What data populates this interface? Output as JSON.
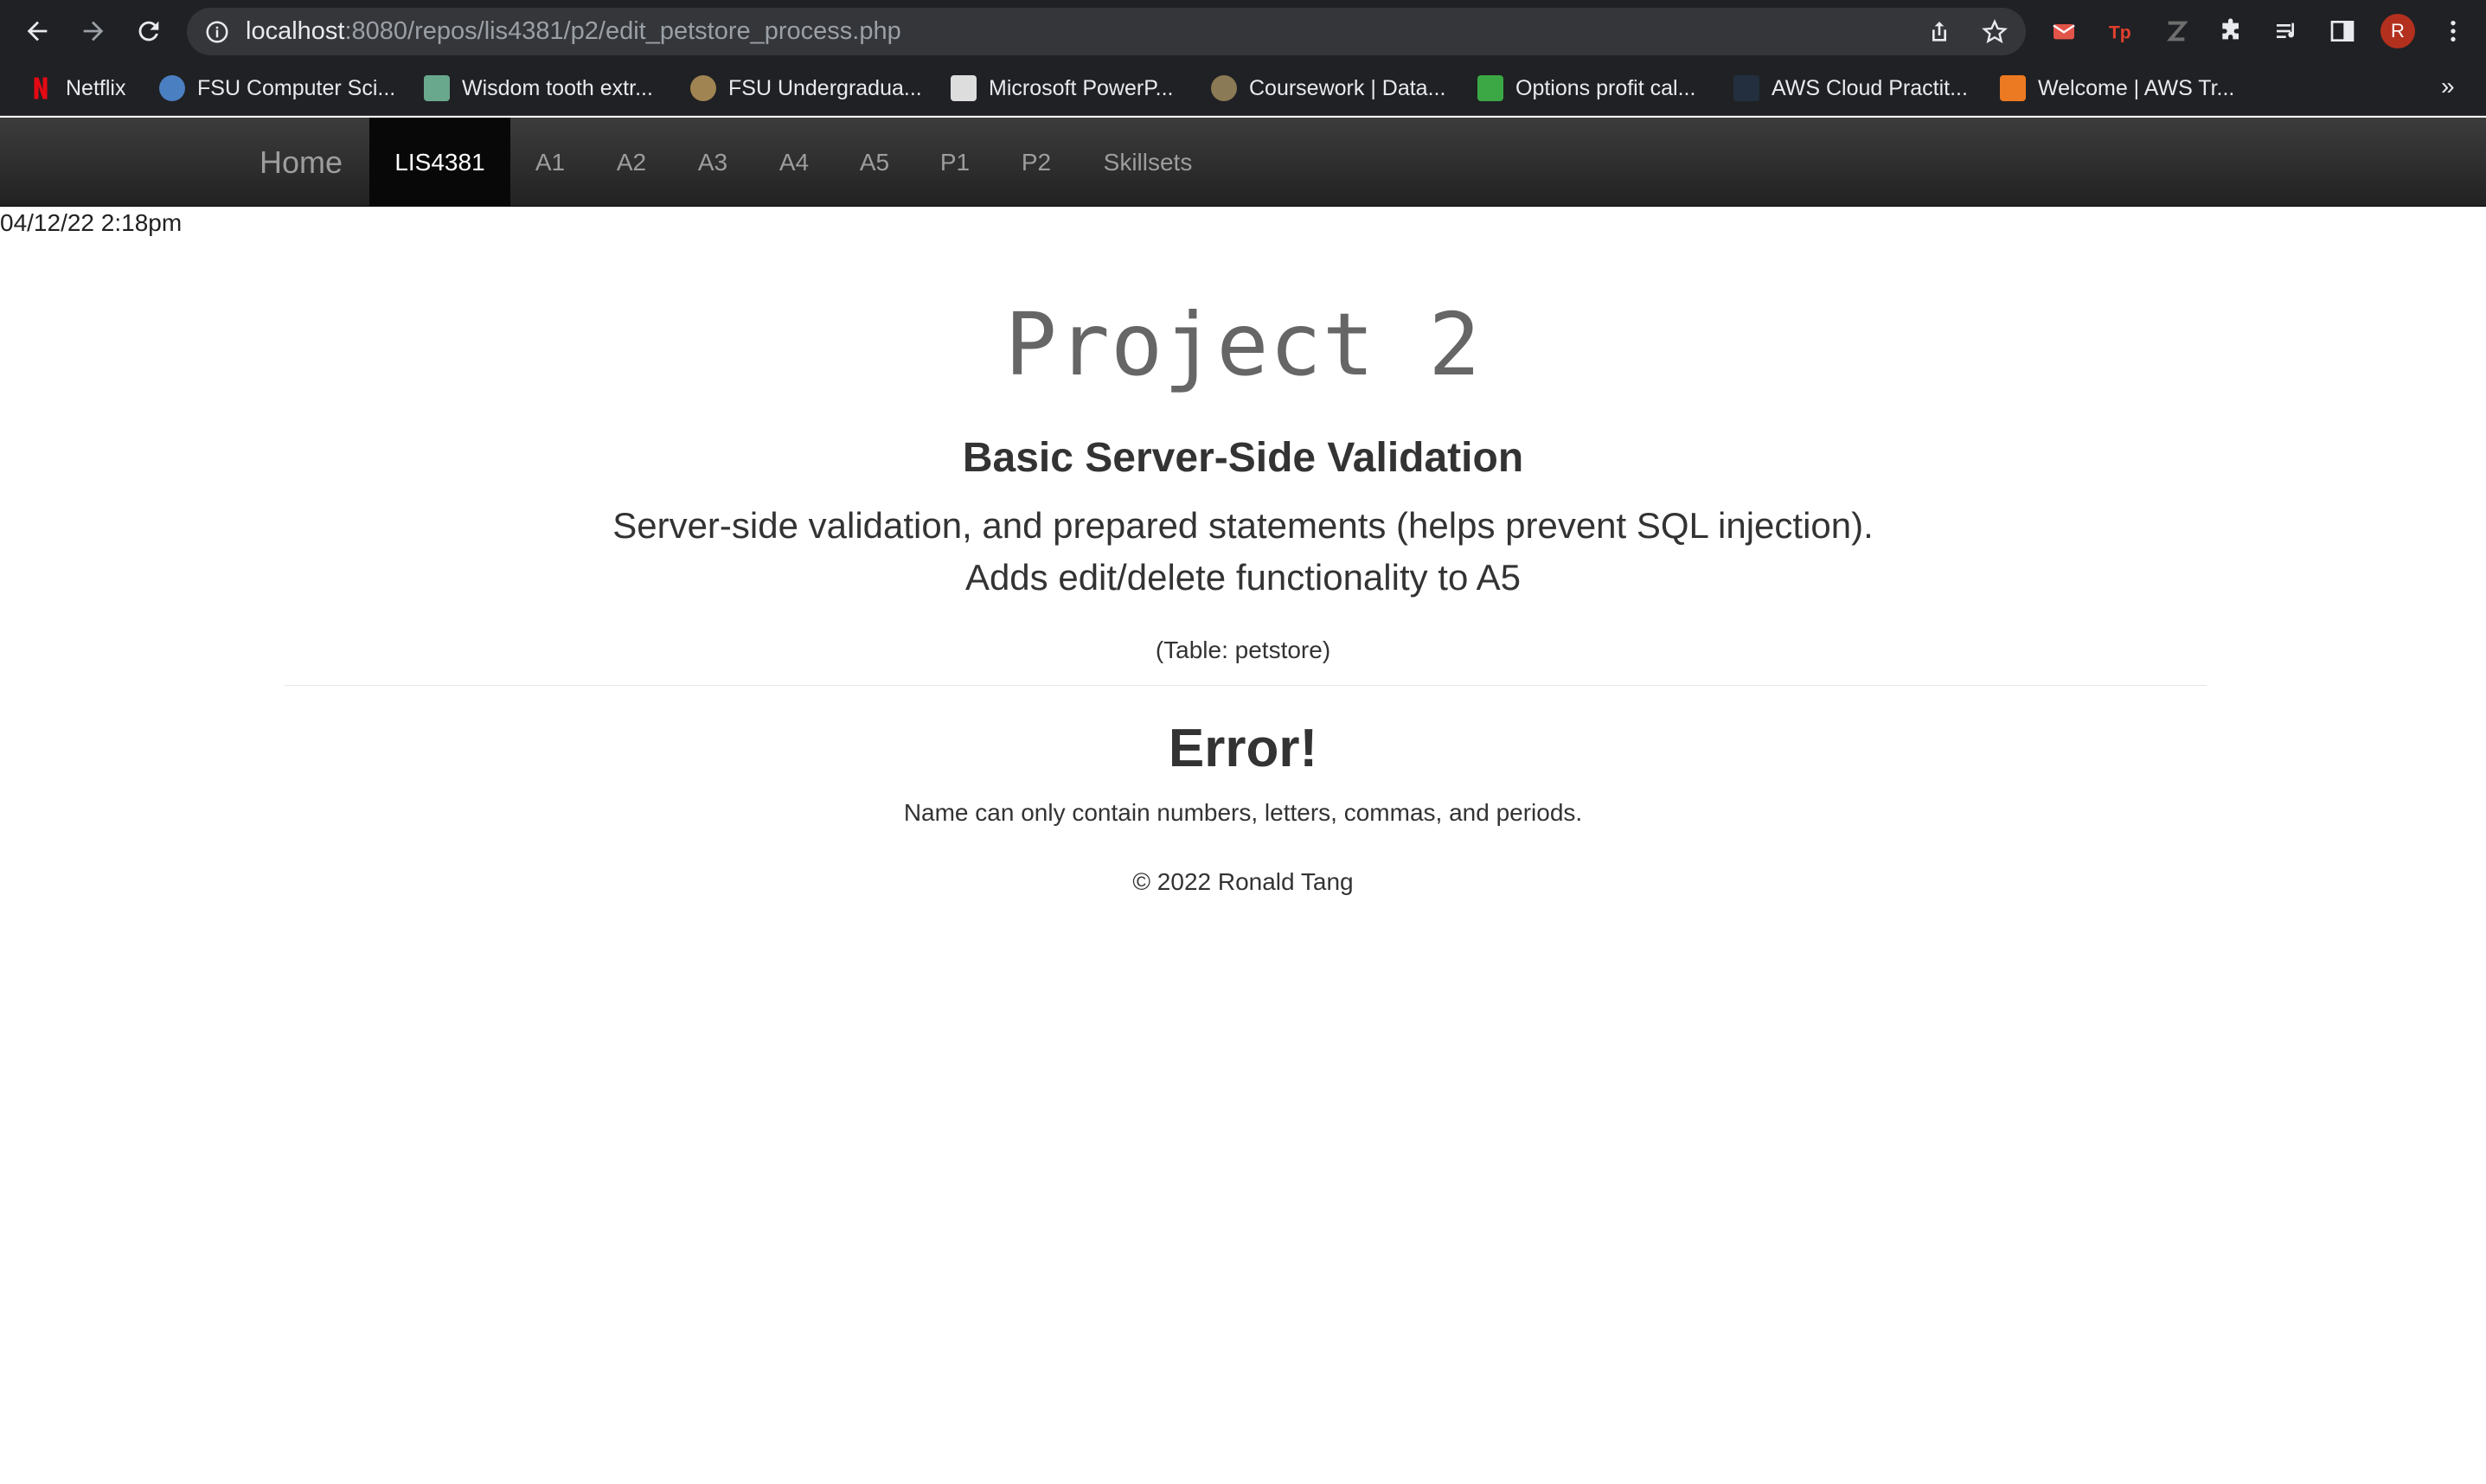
{
  "browser": {
    "url_host": "localhost",
    "url_path": ":8080/repos/lis4381/p2/edit_petstore_process.php",
    "profile_initial": "R",
    "bookmarks": [
      {
        "label": "Netflix",
        "color": "#e50914"
      },
      {
        "label": "FSU Computer Sci...",
        "color": "#4a7fc1"
      },
      {
        "label": "Wisdom tooth extr...",
        "color": "#6aa88e"
      },
      {
        "label": "FSU Undergradua...",
        "color": "#a08452"
      },
      {
        "label": "Microsoft PowerP...",
        "color": "#dddddd"
      },
      {
        "label": "Coursework | Data...",
        "color": "#8a7a55"
      },
      {
        "label": "Options profit cal...",
        "color": "#3ba845"
      },
      {
        "label": "AWS Cloud Practit...",
        "color": "#232f3e"
      },
      {
        "label": "Welcome | AWS Tr...",
        "color": "#ec7a22"
      }
    ]
  },
  "site": {
    "brand": "Home",
    "nav": [
      "LIS4381",
      "A1",
      "A2",
      "A3",
      "A4",
      "A5",
      "P1",
      "P2",
      "Skillsets"
    ],
    "active_nav": "LIS4381",
    "datetime": "04/12/22 2:18pm"
  },
  "content": {
    "title": "Project 2",
    "subtitle": "Basic Server-Side Validation",
    "lead_line1": "Server-side validation, and prepared statements (helps prevent SQL injection).",
    "lead_line2": "Adds edit/delete functionality to A5",
    "table_note": "(Table: petstore)",
    "error_heading": "Error!",
    "error_message": "Name can only contain numbers, letters, commas, and periods.",
    "footer": "© 2022 Ronald Tang"
  }
}
